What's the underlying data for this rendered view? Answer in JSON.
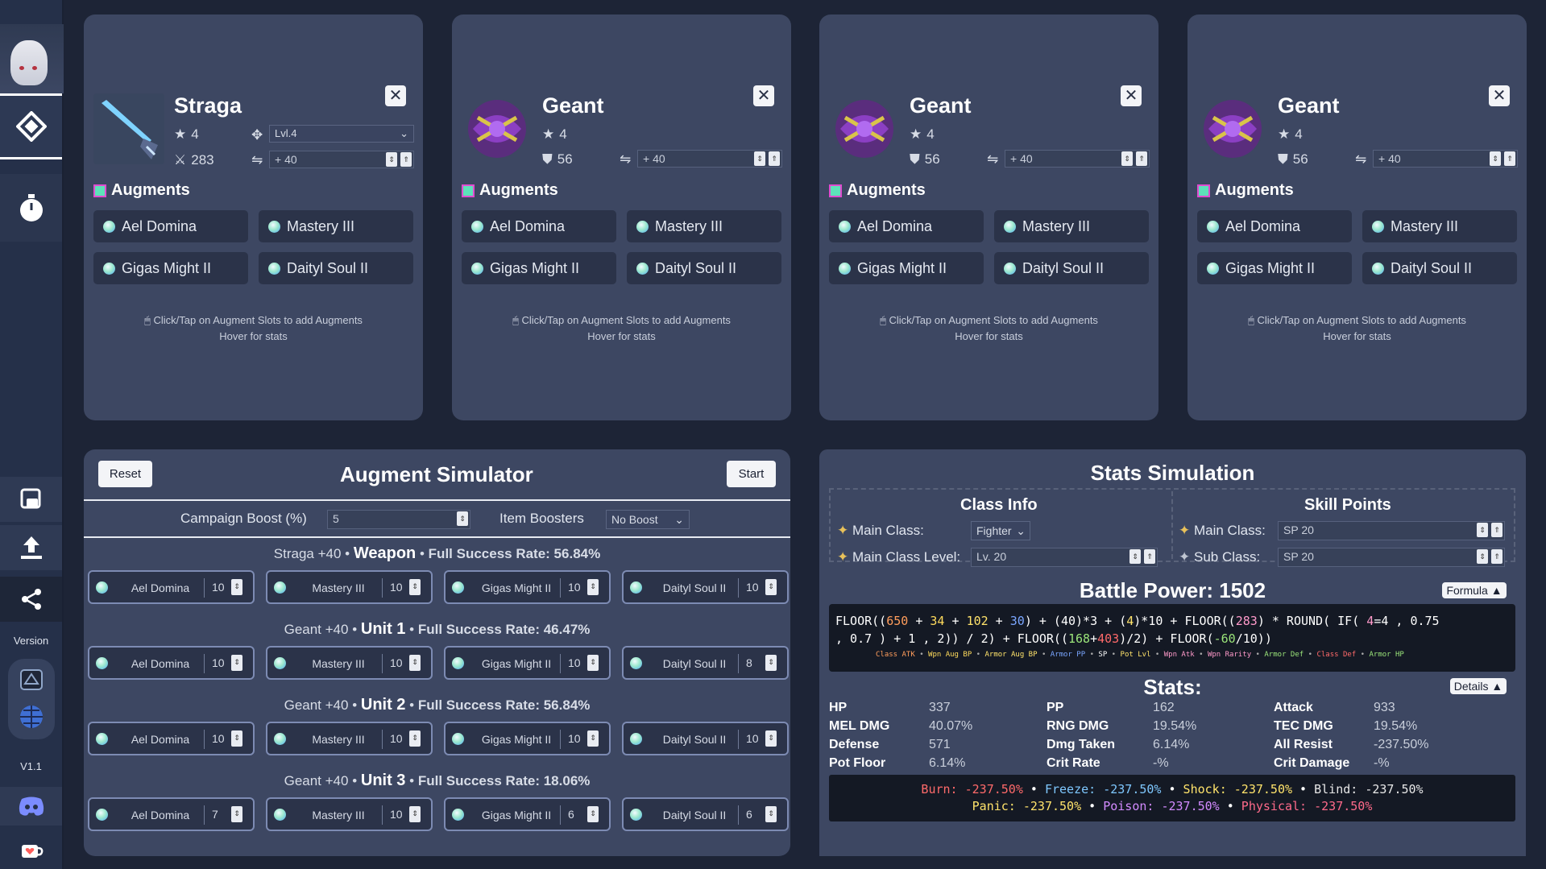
{
  "sidebar": {
    "version_label": "Version",
    "version_value": "V1.1",
    "icons": [
      "home-diamond-icon",
      "timer-icon",
      "save-icon",
      "upload-icon",
      "share-icon",
      "icon-a",
      "globe-icon",
      "discord-icon",
      "kofi-icon"
    ]
  },
  "cards": [
    {
      "name": "Straga",
      "stars": "4",
      "type": "weapon",
      "level_select": "Lvl.4",
      "attack": "283",
      "enhance": "+ 40",
      "augments_title": "Augments",
      "augments": [
        "Ael Domina",
        "Mastery III",
        "Gigas Might II",
        "Daityl Soul II"
      ],
      "hint_line1": "Click/Tap on Augment Slots to add Augments",
      "hint_line2": "Hover for stats"
    },
    {
      "name": "Geant",
      "stars": "4",
      "type": "unit",
      "defense": "56",
      "enhance": "+ 40",
      "augments_title": "Augments",
      "augments": [
        "Ael Domina",
        "Mastery III",
        "Gigas Might II",
        "Daityl Soul II"
      ],
      "hint_line1": "Click/Tap on Augment Slots to add Augments",
      "hint_line2": "Hover for stats"
    },
    {
      "name": "Geant",
      "stars": "4",
      "type": "unit",
      "defense": "56",
      "enhance": "+ 40",
      "augments_title": "Augments",
      "augments": [
        "Ael Domina",
        "Mastery III",
        "Gigas Might II",
        "Daityl Soul II"
      ],
      "hint_line1": "Click/Tap on Augment Slots to add Augments",
      "hint_line2": "Hover for stats"
    },
    {
      "name": "Geant",
      "stars": "4",
      "type": "unit",
      "defense": "56",
      "enhance": "+ 40",
      "augments_title": "Augments",
      "augments": [
        "Ael Domina",
        "Mastery III",
        "Gigas Might II",
        "Daityl Soul II"
      ],
      "hint_line1": "Click/Tap on Augment Slots to add Augments",
      "hint_line2": "Hover for stats"
    }
  ],
  "simulator": {
    "title": "Augment Simulator",
    "reset_label": "Reset",
    "start_label": "Start",
    "campaign_label": "Campaign Boost (%)",
    "campaign_value": "5",
    "boosters_label": "Item Boosters",
    "boosters_value": "No Boost",
    "rows": [
      {
        "item": "Straga +40",
        "slot": "Weapon",
        "rate": "Full Success Rate: 56.84%",
        "slots": [
          {
            "name": "Ael Domina",
            "value": "10"
          },
          {
            "name": "Mastery III",
            "value": "10"
          },
          {
            "name": "Gigas Might II",
            "value": "10"
          },
          {
            "name": "Daityl Soul II",
            "value": "10"
          }
        ]
      },
      {
        "item": "Geant +40",
        "slot": "Unit 1",
        "rate": "Full Success Rate: 46.47%",
        "slots": [
          {
            "name": "Ael Domina",
            "value": "10"
          },
          {
            "name": "Mastery III",
            "value": "10"
          },
          {
            "name": "Gigas Might II",
            "value": "10"
          },
          {
            "name": "Daityl Soul II",
            "value": "8"
          }
        ]
      },
      {
        "item": "Geant +40",
        "slot": "Unit 2",
        "rate": "Full Success Rate: 56.84%",
        "slots": [
          {
            "name": "Ael Domina",
            "value": "10"
          },
          {
            "name": "Mastery III",
            "value": "10"
          },
          {
            "name": "Gigas Might II",
            "value": "10"
          },
          {
            "name": "Daityl Soul II",
            "value": "10"
          }
        ]
      },
      {
        "item": "Geant +40",
        "slot": "Unit 3",
        "rate": "Full Success Rate: 18.06%",
        "slots": [
          {
            "name": "Ael Domina",
            "value": "7"
          },
          {
            "name": "Mastery III",
            "value": "10"
          },
          {
            "name": "Gigas Might II",
            "value": "6"
          },
          {
            "name": "Daityl Soul II",
            "value": "6"
          }
        ]
      }
    ]
  },
  "stats_sim": {
    "title": "Stats Simulation",
    "class_info_title": "Class Info",
    "main_class_label": "Main Class:",
    "main_class_value": "Fighter",
    "main_class_level_label": "Main Class Level:",
    "main_class_level_value": "Lv. 20",
    "skill_points_title": "Skill Points",
    "sp_main_label": "Main Class:",
    "sp_main_value": "SP 20",
    "sp_sub_label": "Sub Class:",
    "sp_sub_value": "SP 20",
    "battle_power": "Battle Power: 1502",
    "formula_btn": "Formula ▲",
    "details_btn": "Details ▲",
    "stats_title": "Stats:",
    "formula_line2": ", 0.7 ) + 1 , 2)) / 2) + FLOOR((",
    "formula_line2_end": ")/2) + FLOOR(",
    "formula_line2_close": "/10))",
    "formula_tokens": {
      "a": "650",
      "b": "34",
      "c": "102",
      "d": "30",
      "e": "40",
      "f": "4",
      "g": "283",
      "h": "4",
      "i": "168",
      "j": "403",
      "k": "-60"
    },
    "legend": [
      "Class ATK",
      "Wpn Aug BP",
      "Armor Aug BP",
      "Armor PP",
      "SP",
      "Pot Lvl",
      "Wpn Atk",
      "Wpn Rarity",
      "Armor Def",
      "Class Def",
      "Armor HP"
    ],
    "stats": [
      {
        "k": "HP",
        "v": "337"
      },
      {
        "k": "PP",
        "v": "162"
      },
      {
        "k": "Attack",
        "v": "933"
      },
      {
        "k": "MEL DMG",
        "v": "40.07%"
      },
      {
        "k": "RNG DMG",
        "v": "19.54%"
      },
      {
        "k": "TEC DMG",
        "v": "19.54%"
      },
      {
        "k": "Defense",
        "v": "571"
      },
      {
        "k": "Dmg Taken",
        "v": "6.14%"
      },
      {
        "k": "All Resist",
        "v": "-237.50%"
      },
      {
        "k": "Pot Floor",
        "v": "6.14%"
      },
      {
        "k": "Crit Rate",
        "v": "-%"
      },
      {
        "k": "Crit Damage",
        "v": "-%"
      }
    ],
    "resists": [
      {
        "k": "Burn:",
        "v": "-237.50%",
        "color": "#ff6a6a"
      },
      {
        "k": "Freeze:",
        "v": "-237.50%",
        "color": "#7fc8ff"
      },
      {
        "k": "Shock:",
        "v": "-237.50%",
        "color": "#ffe36b"
      },
      {
        "k": "Blind:",
        "v": "-237.50%",
        "color": "#e8e8e8"
      },
      {
        "k": "Panic:",
        "v": "-237.50%",
        "color": "#ffe36b"
      },
      {
        "k": "Poison:",
        "v": "-237.50%",
        "color": "#d38bff"
      },
      {
        "k": "Physical:",
        "v": "-237.50%",
        "color": "#ff6a8a"
      }
    ]
  }
}
